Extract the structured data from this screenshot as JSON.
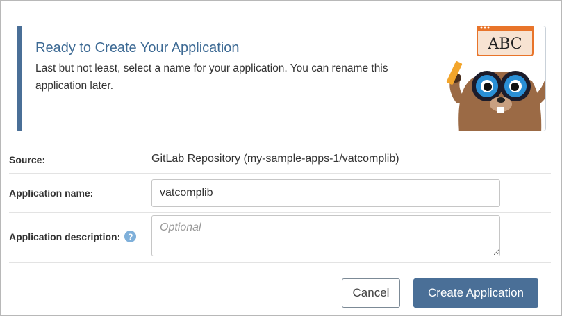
{
  "banner": {
    "title": "Ready to Create Your Application",
    "text": "Last but not least, select a name for your application. You can rename this application later.",
    "mascot_sign": "ABC"
  },
  "form": {
    "source": {
      "label": "Source:",
      "value": "GitLab Repository (my-sample-apps-1/vatcomplib)"
    },
    "application_name": {
      "label": "Application name:",
      "value": "vatcomplib"
    },
    "application_description": {
      "label": "Application description:",
      "help_icon": "?",
      "placeholder": "Optional",
      "value": ""
    }
  },
  "buttons": {
    "cancel": "Cancel",
    "create": "Create Application"
  },
  "colors": {
    "accent": "#4a6f97",
    "title": "#3d6a94",
    "help_icon": "#7fb0da"
  }
}
